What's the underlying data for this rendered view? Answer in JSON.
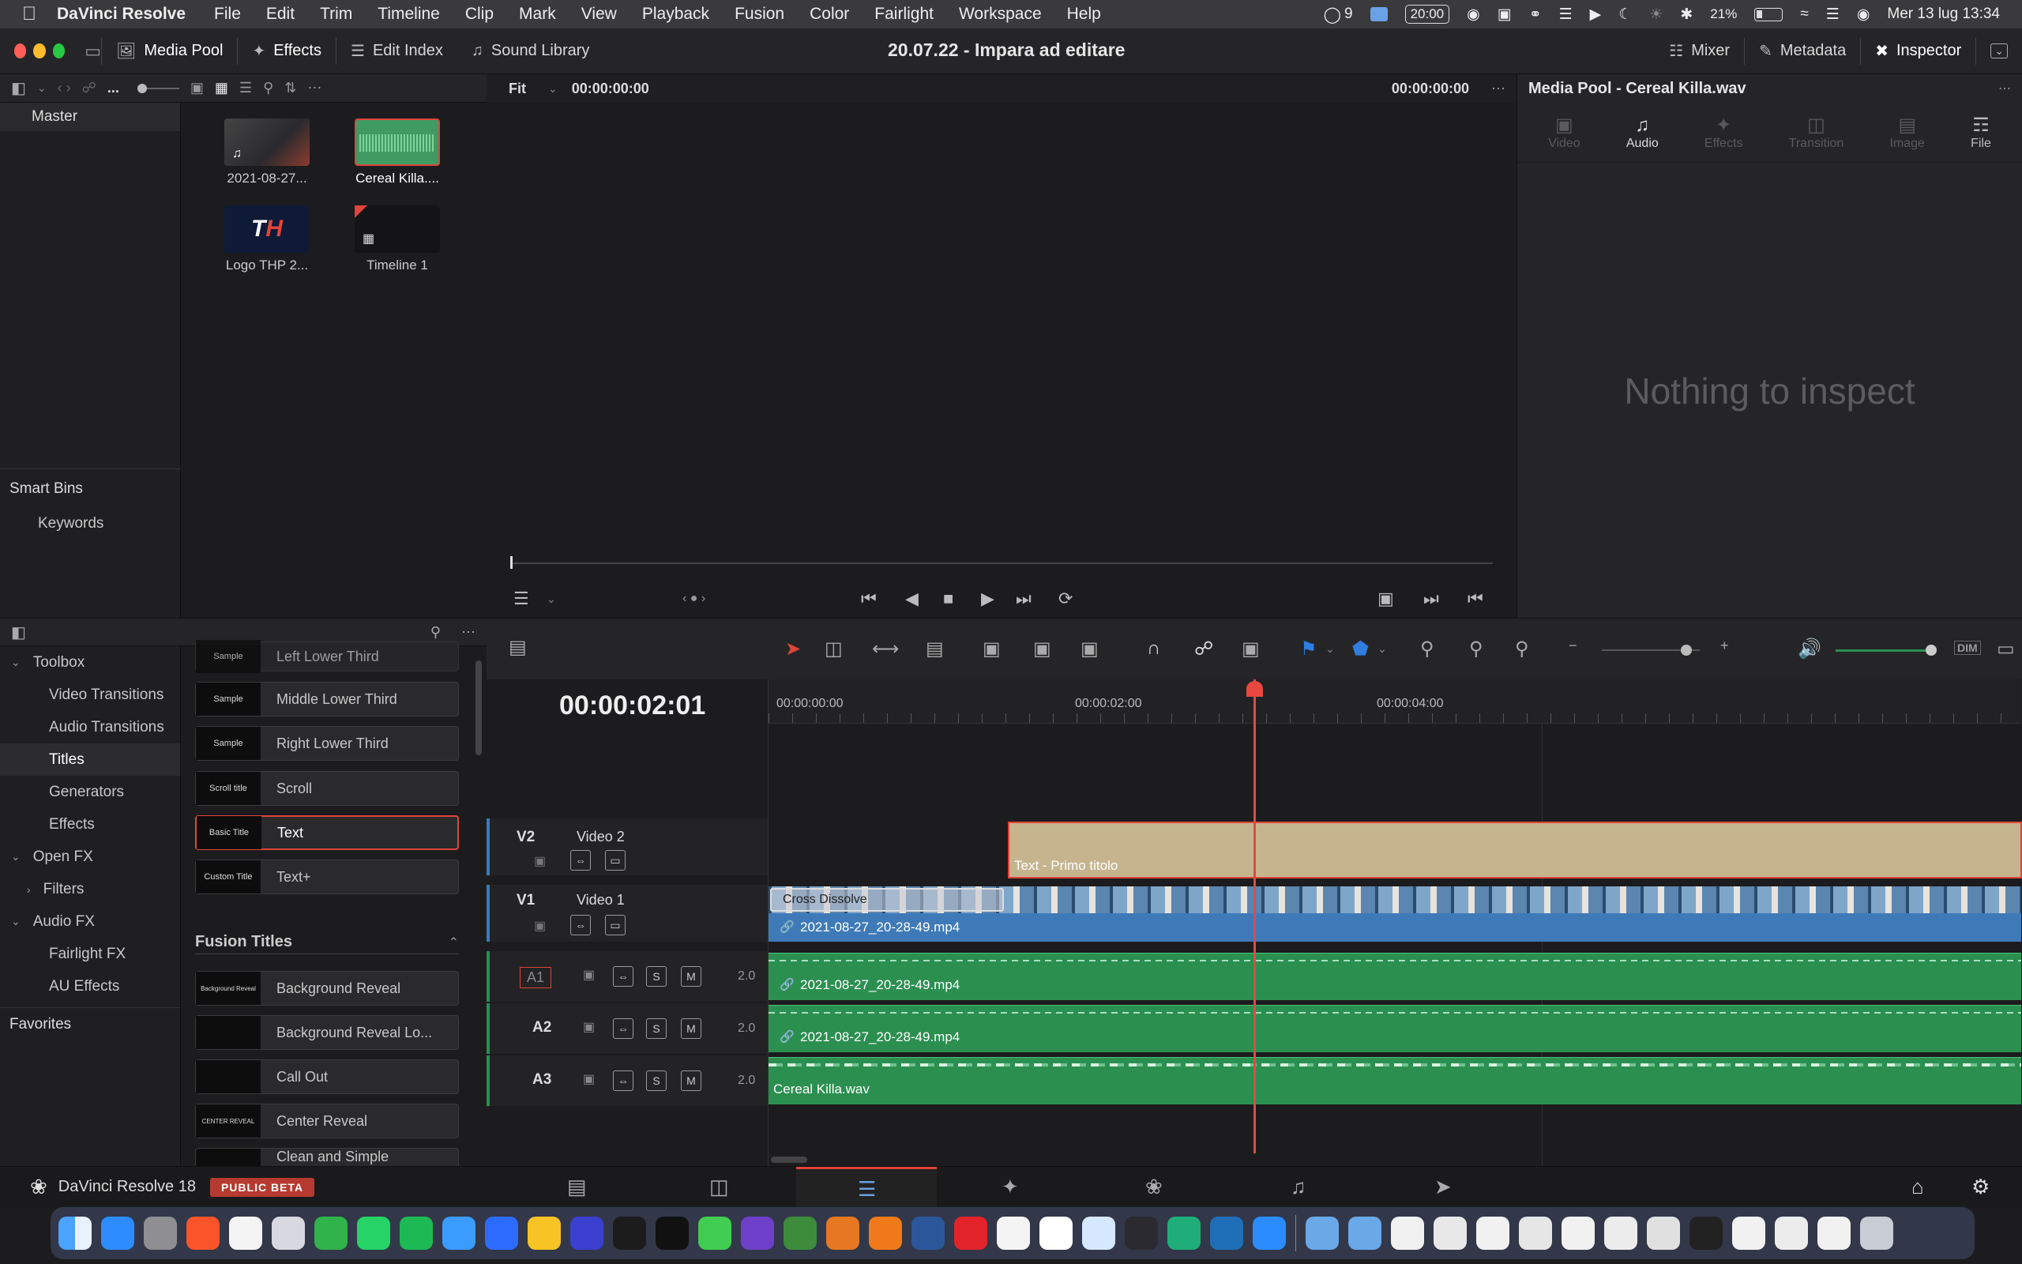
{
  "menubar": {
    "apple": "",
    "app": "DaVinci Resolve",
    "items": [
      "File",
      "Edit",
      "Trim",
      "Timeline",
      "Clip",
      "Mark",
      "View",
      "Playback",
      "Fusion",
      "Color",
      "Fairlight",
      "Workspace",
      "Help"
    ],
    "status_count": "9",
    "clock_box": "20:00",
    "battery": "21%",
    "datetime": "Mer 13 lug  13:34"
  },
  "toolbar": {
    "media_pool": "Media Pool",
    "effects": "Effects",
    "edit_index": "Edit Index",
    "sound_library": "Sound Library",
    "project_title": "20.07.22 - Impara ad editare",
    "mixer": "Mixer",
    "metadata": "Metadata",
    "inspector": "Inspector"
  },
  "media_pool": {
    "more": "...",
    "bin": "Master",
    "clips": [
      {
        "label": "2021-08-27..."
      },
      {
        "label": "Cereal Killa...."
      },
      {
        "label": "Logo THP 2..."
      },
      {
        "label": "Timeline 1"
      }
    ],
    "smart_bins": "Smart Bins",
    "keywords": "Keywords"
  },
  "viewer": {
    "fit": "Fit",
    "timecode_left": "00:00:00:00",
    "timecode_right": "00:00:00:00"
  },
  "inspector": {
    "title": "Media Pool - Cereal Killa.wav",
    "tabs": [
      "Video",
      "Audio",
      "Effects",
      "Transition",
      "Image",
      "File"
    ],
    "empty": "Nothing to inspect"
  },
  "effects": {
    "toolbox": "Toolbox",
    "items": [
      "Video Transitions",
      "Audio Transitions",
      "Titles",
      "Generators",
      "Effects"
    ],
    "open_fx": "Open FX",
    "filters": "Filters",
    "audio_fx": "Audio FX",
    "fairlight_fx": "Fairlight FX",
    "au_effects": "AU Effects",
    "favorites": "Favorites",
    "titles": [
      {
        "thumb": "Sample",
        "label": "Left Lower Third"
      },
      {
        "thumb": "Sample",
        "label": "Middle Lower Third"
      },
      {
        "thumb": "Sample",
        "label": "Right Lower Third"
      },
      {
        "thumb": "Scroll title",
        "label": "Scroll"
      },
      {
        "thumb": "Basic Title",
        "label": "Text"
      },
      {
        "thumb": "Custom Title",
        "label": "Text+"
      }
    ],
    "fusion_titles_header": "Fusion Titles",
    "fusion_titles": [
      {
        "thumb": "Background Reveal",
        "label": "Background Reveal"
      },
      {
        "thumb": "",
        "label": "Background Reveal Lo..."
      },
      {
        "thumb": "",
        "label": "Call Out"
      },
      {
        "thumb": "CENTER REVEAL",
        "label": "Center Reveal"
      },
      {
        "thumb": "",
        "label": "Clean and Simple"
      }
    ]
  },
  "timeline": {
    "timecode": "00:00:02:01",
    "ruler": [
      "00:00:00:00",
      "00:00:02:00",
      "00:00:04:00"
    ],
    "v2": {
      "id": "V2",
      "name": "Video 2",
      "clip": "Text - Primo titolo"
    },
    "v1": {
      "id": "V1",
      "name": "Video 1",
      "transition": "Cross Dissolve",
      "clip": "2021-08-27_20-28-49.mp4"
    },
    "a1": {
      "id": "A1",
      "level": "2.0",
      "clip": "2021-08-27_20-28-49.mp4"
    },
    "a2": {
      "id": "A2",
      "level": "2.0",
      "clip": "2021-08-27_20-28-49.mp4"
    },
    "a3": {
      "id": "A3",
      "level": "2.0",
      "clip": "Cereal Killa.wav"
    },
    "solo": "S",
    "mute": "M",
    "dim": "DIM"
  },
  "footer": {
    "app_name": "DaVinci Resolve 18",
    "beta": "PUBLIC BETA"
  },
  "colors": {
    "accent_red": "#e0443a",
    "playhead": "#e8473f",
    "audio_green": "#2b8f50",
    "video_blue": "#3f7ab8",
    "title_tan": "#c6b48f"
  }
}
